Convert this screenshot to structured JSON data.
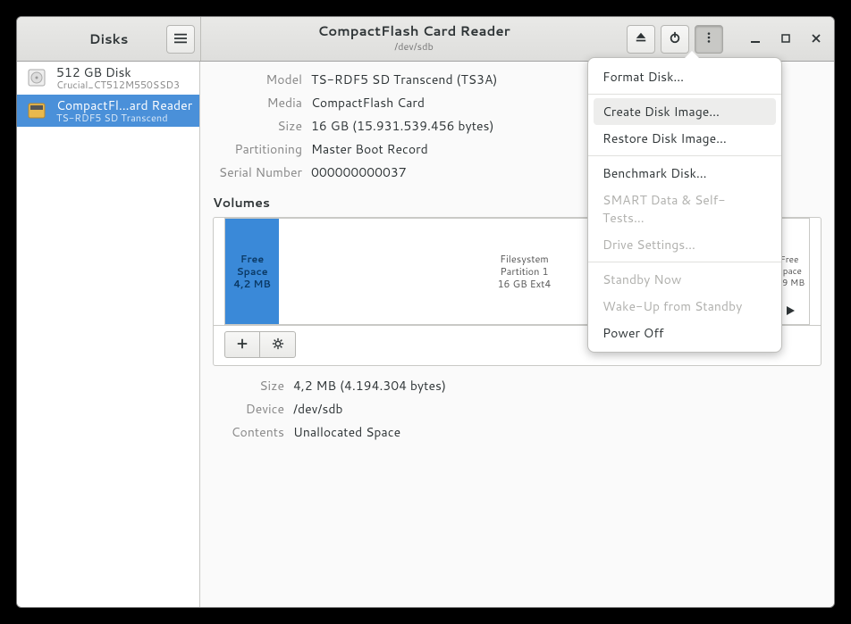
{
  "app": {
    "title": "Disks"
  },
  "header": {
    "title": "CompactFlash Card Reader",
    "subtitle": "/dev/sdb"
  },
  "sidebar": {
    "devices": [
      {
        "name": "512 GB Disk",
        "sub": "Crucial_CT512M550SSD3",
        "selected": false,
        "kind": "ssd"
      },
      {
        "name": "CompactFl…ard Reader",
        "sub": "TS-RDF5 SD  Transcend",
        "selected": true,
        "kind": "cf"
      }
    ]
  },
  "info": {
    "labels": {
      "model": "Model",
      "media": "Media",
      "size": "Size",
      "partitioning": "Partitioning",
      "serial": "Serial Number"
    },
    "model": "TS-RDF5 SD  Transcend (TS3A)",
    "media": "CompactFlash Card",
    "size": "16 GB (15.931.539.456 bytes)",
    "partitioning": "Master Boot Record",
    "serial": "000000000037"
  },
  "volumes": {
    "title": "Volumes",
    "segments": {
      "free_left": {
        "l1": "Free Space",
        "l2": "4,2 MB"
      },
      "fs": {
        "l1": "Filesystem",
        "l2": "Partition 1",
        "l3": "16 GB Ext4"
      },
      "free_right": {
        "l1": "Free Space",
        "l2": "0,9 MB"
      }
    }
  },
  "selection": {
    "labels": {
      "size": "Size",
      "device": "Device",
      "contents": "Contents"
    },
    "size": "4,2 MB (4.194.304 bytes)",
    "device": "/dev/sdb",
    "contents": "Unallocated Space"
  },
  "icons": {
    "hamburger": "hamburger-icon",
    "eject": "eject-icon",
    "power": "power-icon",
    "kebab": "kebab-icon",
    "min": "minimize-icon",
    "max": "maximize-icon",
    "close": "close-icon",
    "plus": "plus-icon",
    "gear": "gear-icon",
    "play": "play-icon"
  },
  "menu": {
    "format_disk": "Format Disk…",
    "create_image": "Create Disk Image…",
    "restore_image": "Restore Disk Image…",
    "benchmark": "Benchmark Disk…",
    "smart": "SMART Data & Self-Tests…",
    "drive_settings": "Drive Settings…",
    "standby_now": "Standby Now",
    "wake_up": "Wake-Up from Standby",
    "power_off": "Power Off"
  }
}
